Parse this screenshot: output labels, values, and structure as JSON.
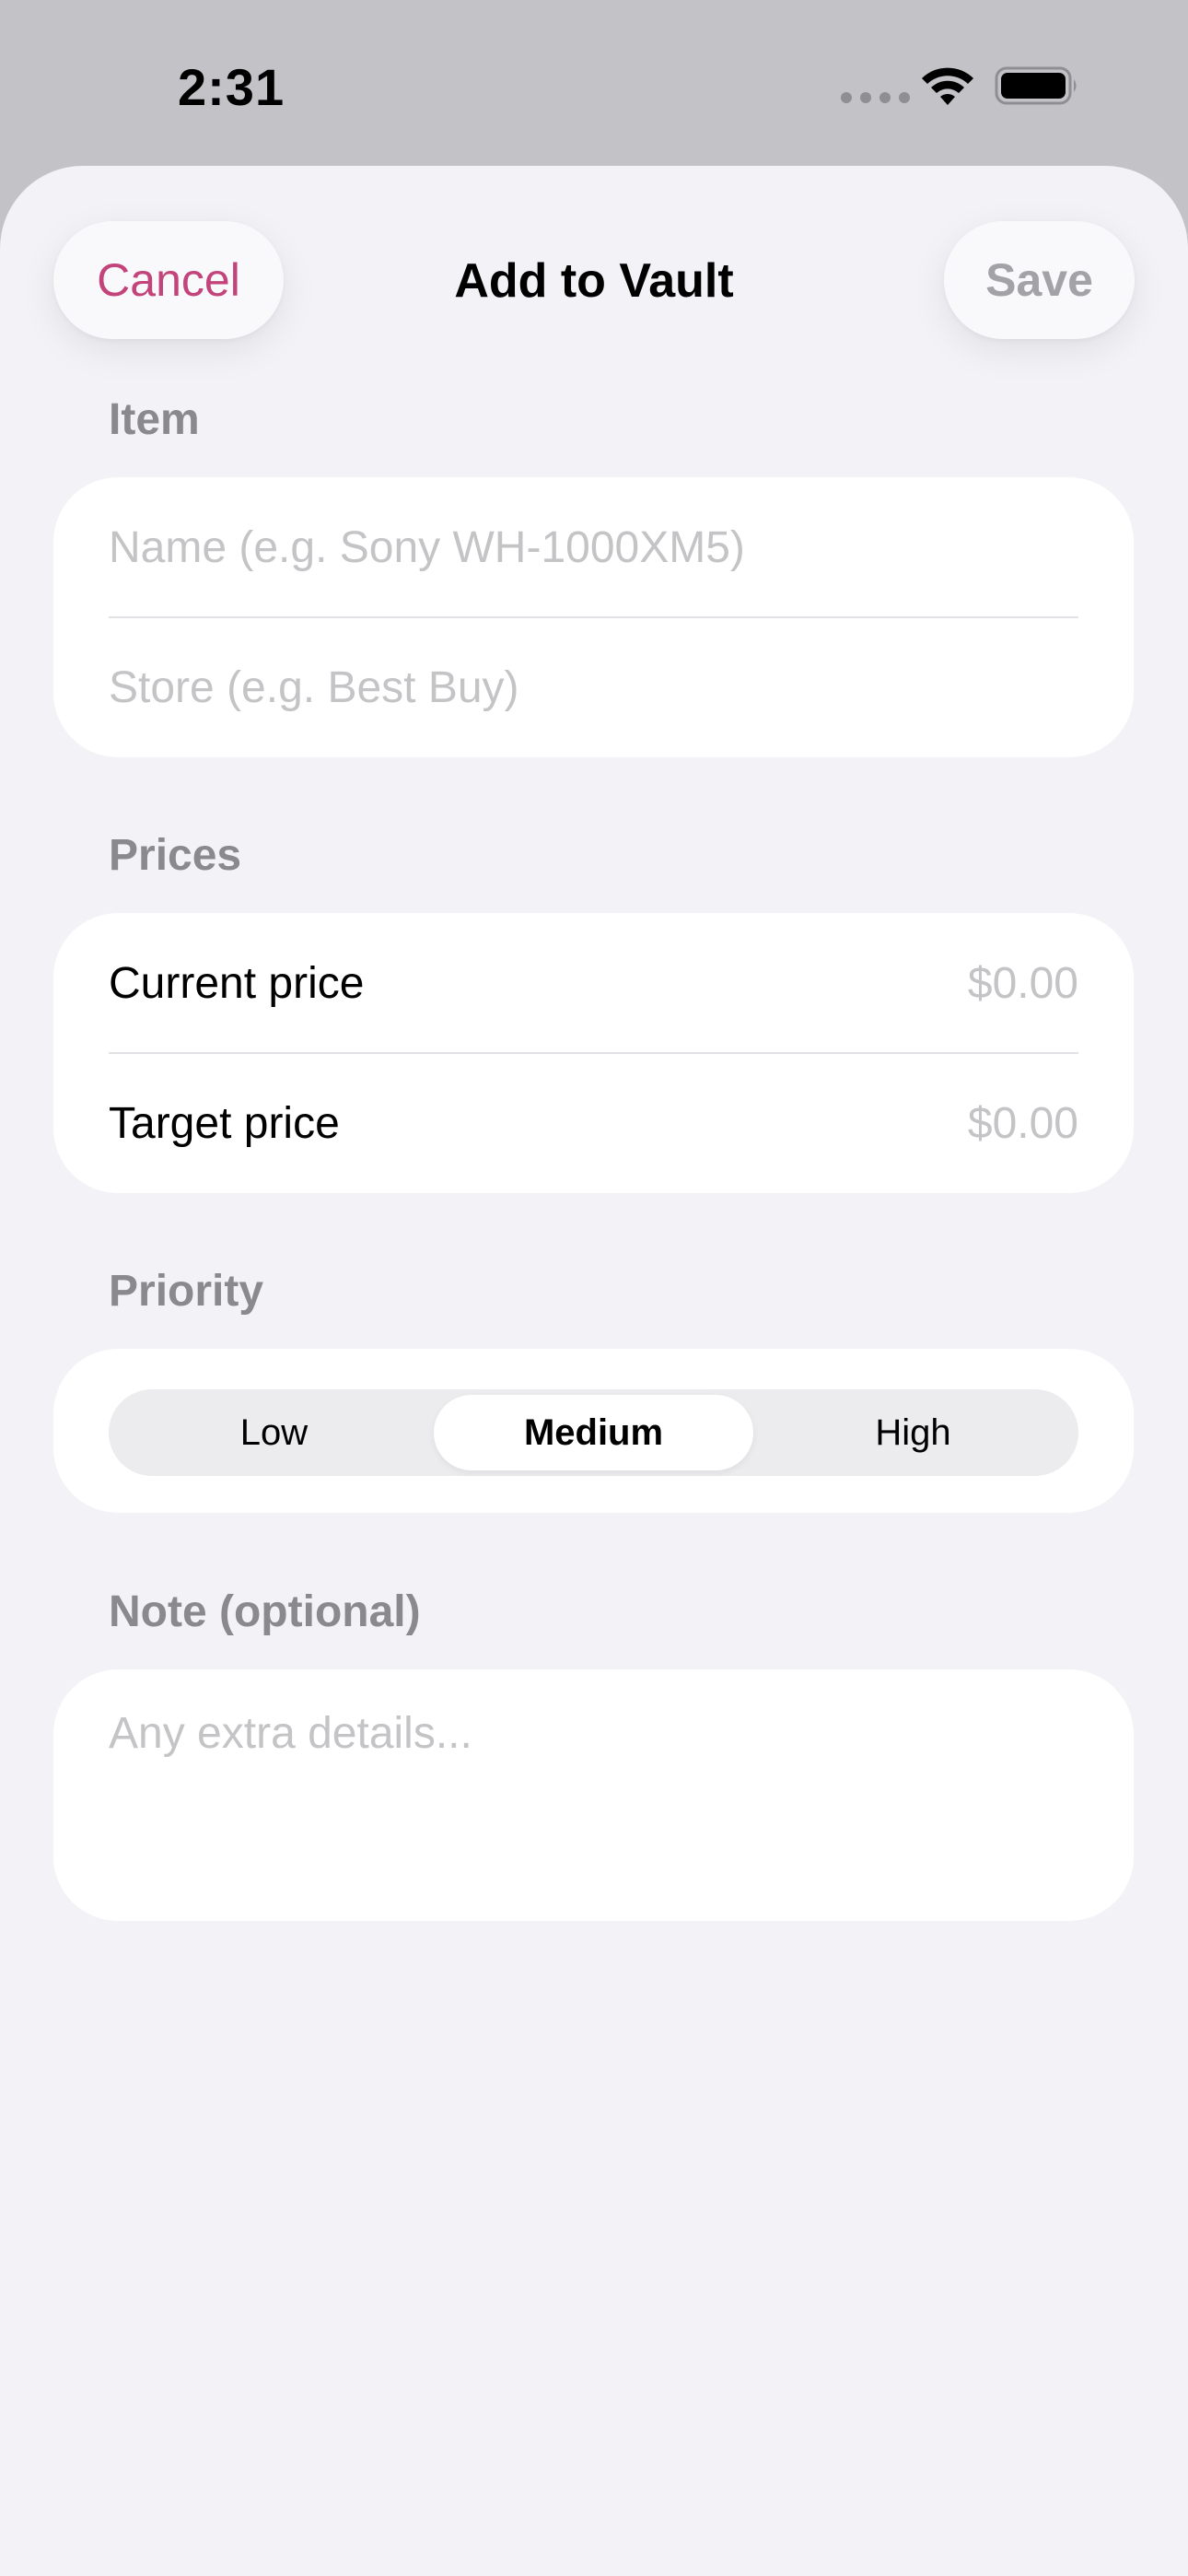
{
  "status_bar": {
    "time": "2:31"
  },
  "nav": {
    "cancel_label": "Cancel",
    "title": "Add to Vault",
    "save_label": "Save"
  },
  "sections": {
    "item": {
      "label": "Item",
      "name_placeholder": "Name (e.g. Sony WH-1000XM5)",
      "store_placeholder": "Store (e.g. Best Buy)"
    },
    "prices": {
      "label": "Prices",
      "current_label": "Current price",
      "current_value": "$0.00",
      "target_label": "Target price",
      "target_value": "$0.00"
    },
    "priority": {
      "label": "Priority",
      "options": [
        "Low",
        "Medium",
        "High"
      ],
      "selected": "Medium"
    },
    "note": {
      "label": "Note (optional)",
      "placeholder": "Any extra details..."
    }
  },
  "colors": {
    "accent": "#c2447a",
    "background": "#f2f2f7",
    "card": "#ffffff",
    "secondary_text": "#8a8a8e",
    "placeholder": "#c4c4c7"
  }
}
